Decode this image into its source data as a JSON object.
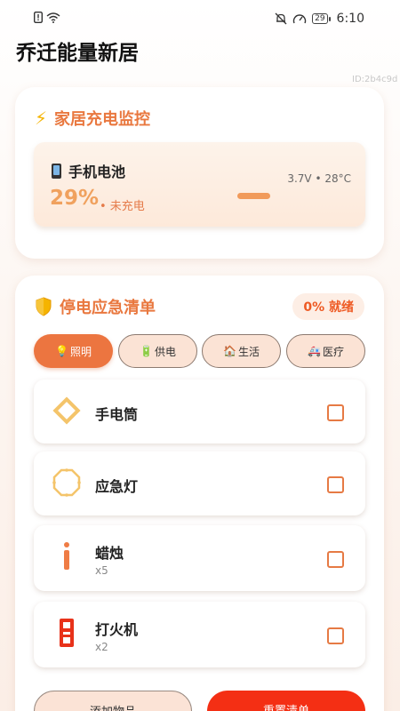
{
  "status_bar": {
    "time": "6:10",
    "battery_level": "29",
    "left_icons": [
      "sim-alert-icon",
      "wifi-icon"
    ],
    "right_icons": [
      "bell-muted-icon",
      "speedometer-icon",
      "battery-icon"
    ]
  },
  "app_title": "乔迁能量新居",
  "watermark": "ID:2b4c9d",
  "monitor": {
    "title": "家居充电监控",
    "device_name": "手机电池",
    "battery_percent": "29%",
    "charge_state": "• 未充电",
    "volt_temp": "3.7V • 28°C"
  },
  "checklist": {
    "title": "停电应急清单",
    "ready_status": "0% 就绪",
    "tabs": [
      {
        "icon": "💡",
        "label": "照明",
        "active": true
      },
      {
        "icon": "🔋",
        "label": "供电",
        "active": false
      },
      {
        "icon": "🏠",
        "label": "生活",
        "active": false
      },
      {
        "icon": "🚑",
        "label": "医疗",
        "active": false
      }
    ],
    "items": [
      {
        "name": "手电筒",
        "qty": "",
        "checked": false
      },
      {
        "name": "应急灯",
        "qty": "",
        "checked": false
      },
      {
        "name": "蜡烛",
        "qty": "x5",
        "checked": false
      },
      {
        "name": "打火机",
        "qty": "x2",
        "checked": false
      }
    ],
    "add_button": "添加物品",
    "reset_button": "重置清单"
  },
  "colors": {
    "accent": "#e9783f",
    "active_tab": "#ec7540",
    "reset_button": "#f42f14",
    "battery_percent": "#f0a15e"
  }
}
